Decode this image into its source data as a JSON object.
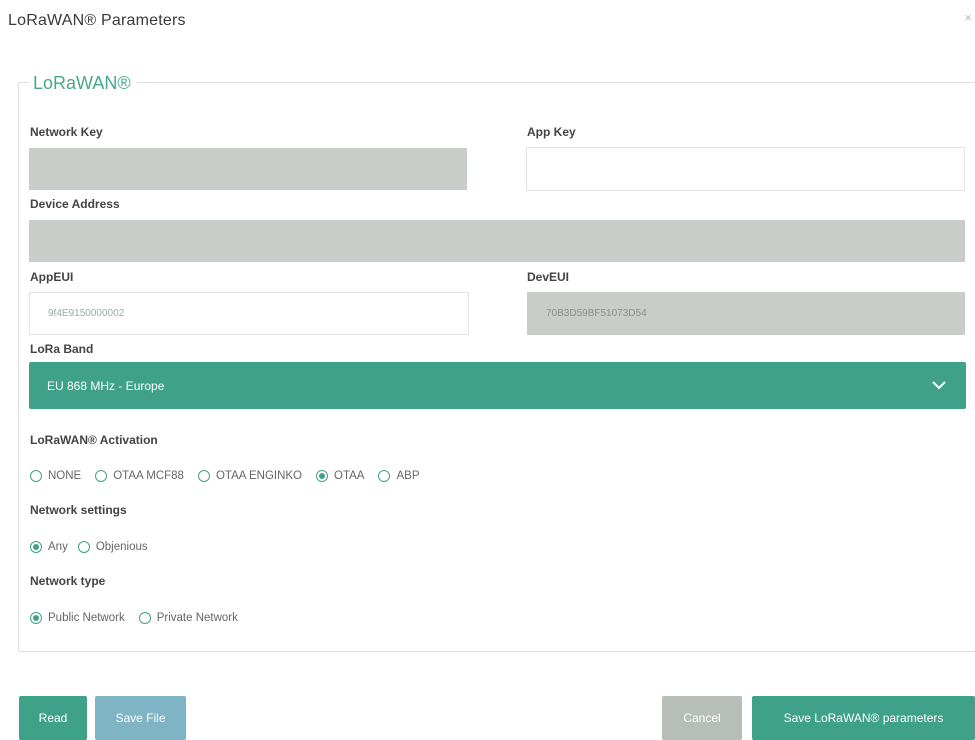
{
  "dialog": {
    "title": "LoRaWAN® Parameters",
    "close": "×"
  },
  "group": {
    "legend": "LoRaWAN®"
  },
  "fields": {
    "network_key": {
      "label": "Network Key",
      "value": ""
    },
    "app_key": {
      "label": "App Key",
      "value": ""
    },
    "device_address": {
      "label": "Device Address",
      "value": ""
    },
    "app_eui": {
      "label": "AppEUI",
      "value": "9f4E9150000002"
    },
    "dev_eui": {
      "label": "DevEUI",
      "value": "70B3D59BF51073D54"
    }
  },
  "lora_band": {
    "label": "LoRa Band",
    "selected": "EU 868 MHz - Europe"
  },
  "activation": {
    "label": "LoRaWAN® Activation",
    "options": [
      "NONE",
      "OTAA MCF88",
      "OTAA ENGINKO",
      "OTAA",
      "ABP"
    ],
    "selected": "OTAA"
  },
  "network_settings": {
    "label": "Network settings",
    "options": [
      "Any",
      "Objenious"
    ],
    "selected": "Any"
  },
  "network_type": {
    "label": "Network type",
    "options": [
      "Public Network",
      "Private Network"
    ],
    "selected": "Public Network"
  },
  "buttons": {
    "read": "Read",
    "save_file": "Save File",
    "cancel": "Cancel",
    "save_params": "Save LoRaWAN® parameters"
  },
  "colors": {
    "accent": "#3fa188",
    "save_file": "#7fb4c4",
    "cancel": "#b7bdb7",
    "disabled_input": "#c9cdc9"
  }
}
